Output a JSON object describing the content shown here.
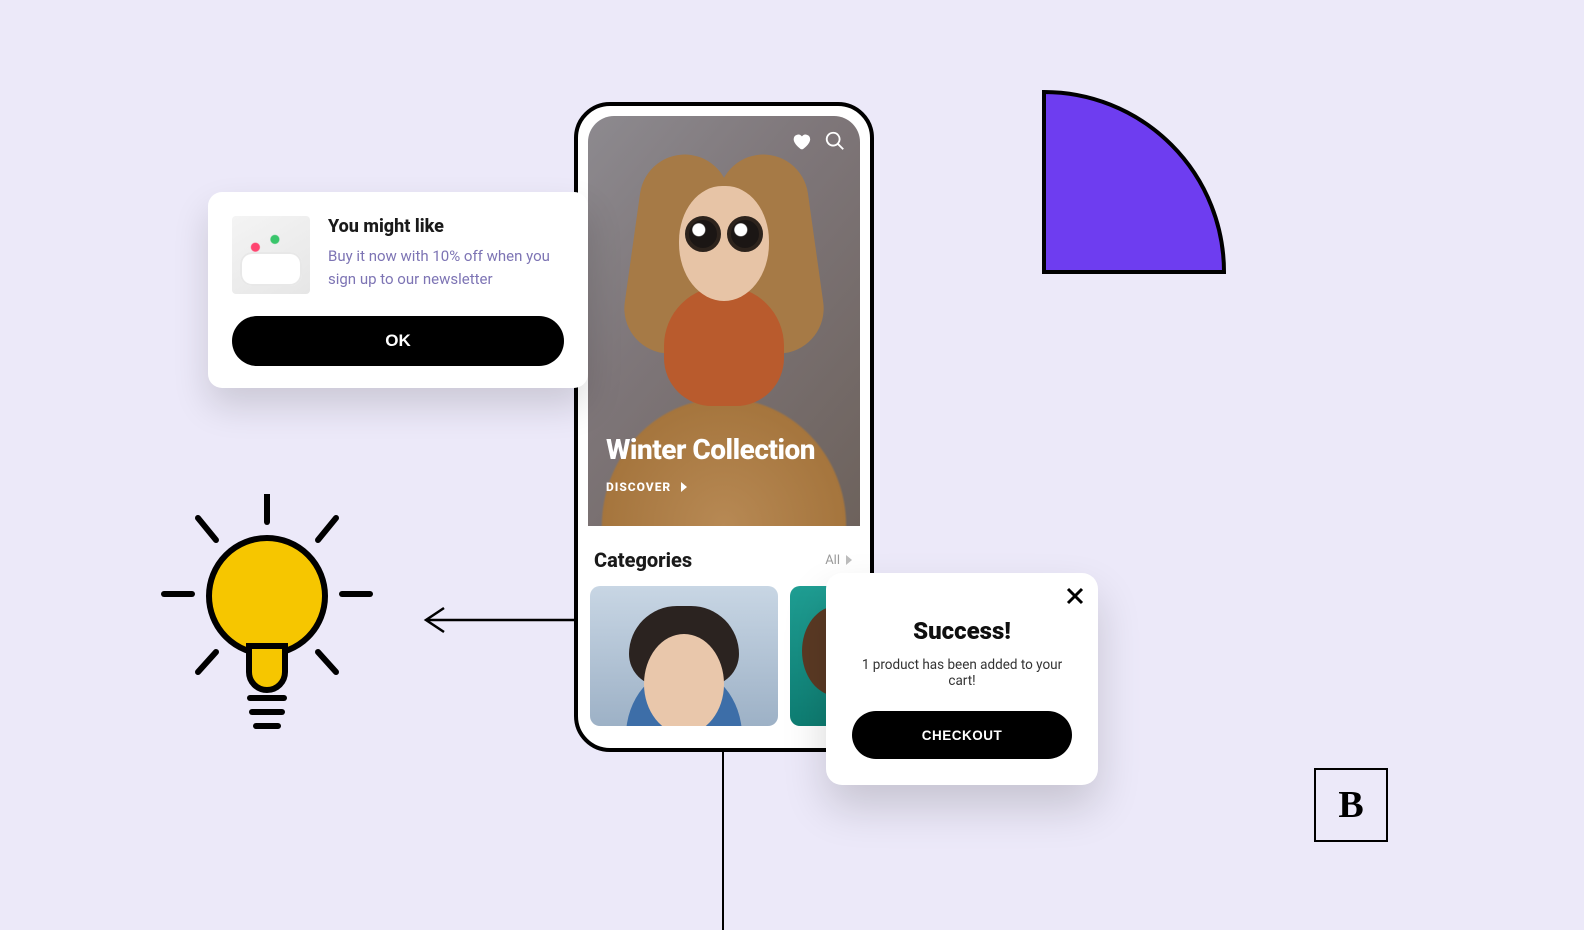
{
  "suggestion": {
    "title": "You might like",
    "body": "Buy it now with 10% off when you sign up to our newsletter",
    "ok_label": "OK"
  },
  "phone": {
    "hero_title": "Winter Collection",
    "discover_label": "DISCOVER",
    "categories_heading": "Categories",
    "categories_all_label": "All"
  },
  "success": {
    "title": "Success!",
    "message": "1 product has been added to your cart!",
    "checkout_label": "CHECKOUT"
  },
  "logo": {
    "letter": "B"
  },
  "colors": {
    "background": "#ece9f9",
    "accent_purple": "#6e3df0",
    "bulb_yellow": "#f6c600"
  }
}
